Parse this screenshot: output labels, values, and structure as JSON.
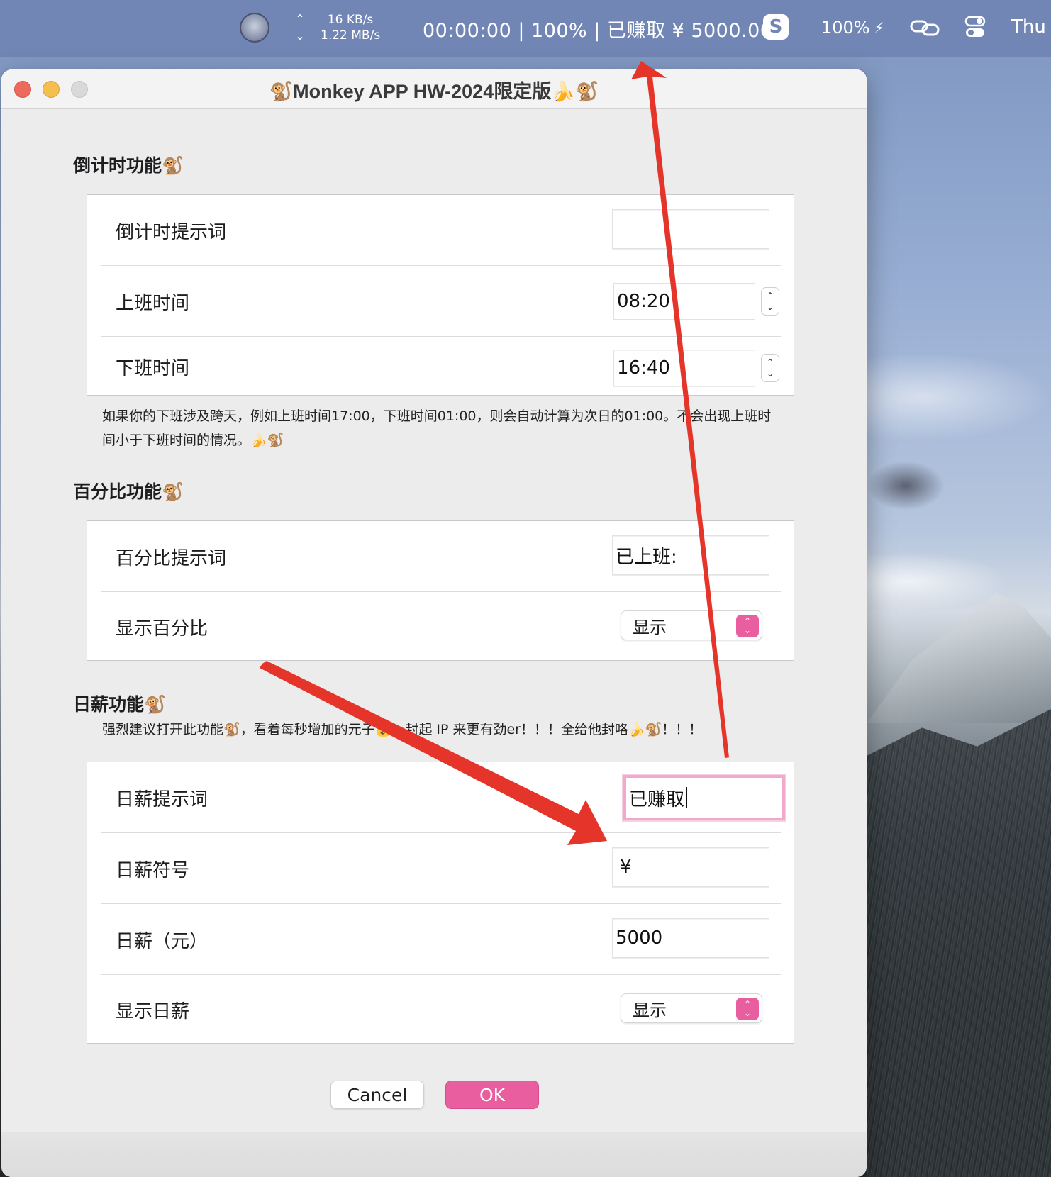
{
  "menubar": {
    "net_up_arrow": "⌃",
    "net_down_arrow": "⌄",
    "net_up_rate": "16 KB/s",
    "net_down_rate": "1.22 MB/s",
    "status": "00:00:00 | 100% | 已赚取 ¥ 5000.00",
    "app_icon_letter": "S",
    "battery": "100%",
    "battery_bolt": "⚡",
    "clock": "Thu"
  },
  "window": {
    "title": "🐒Monkey APP HW-2024限定版🍌🐒"
  },
  "countdown": {
    "heading": "倒计时功能🐒",
    "rows": {
      "prompt_label": "倒计时提示词",
      "prompt_value": "",
      "start_label": "上班时间",
      "start_value": "08:20",
      "end_label": "下班时间",
      "end_value": "16:40"
    },
    "note_line1": "如果你的下班涉及跨天，例如上班时间17:00，下班时间01:00，则会自动计算为次日的01:00。不会出现上班时",
    "note_line2": "间小于下班时间的情况。🍌🐒"
  },
  "percent": {
    "heading": "百分比功能🐒",
    "rows": {
      "prompt_label": "百分比提示词",
      "prompt_value": "已上班:",
      "show_label": "显示百分比",
      "show_value": "显示"
    }
  },
  "salary": {
    "heading": "日薪功能🐒",
    "note": "强烈建议打开此功能🐒，看着每秒增加的元子💰，封起 IP 来更有劲er！！！全给他封咯🍌🐒！！！",
    "rows": {
      "prompt_label": "日薪提示词",
      "prompt_value": "已赚取",
      "symbol_label": "日薪符号",
      "symbol_value": "¥",
      "amount_label": "日薪（元）",
      "amount_value": "5000",
      "show_label": "显示日薪",
      "show_value": "显示"
    }
  },
  "buttons": {
    "cancel": "Cancel",
    "ok": "OK"
  },
  "stepper": {
    "up": "⌃",
    "down": "⌄"
  },
  "colors": {
    "accent": "#e85e9f",
    "annotation_arrow": "#e5352a",
    "menubar": "#7186b4"
  }
}
